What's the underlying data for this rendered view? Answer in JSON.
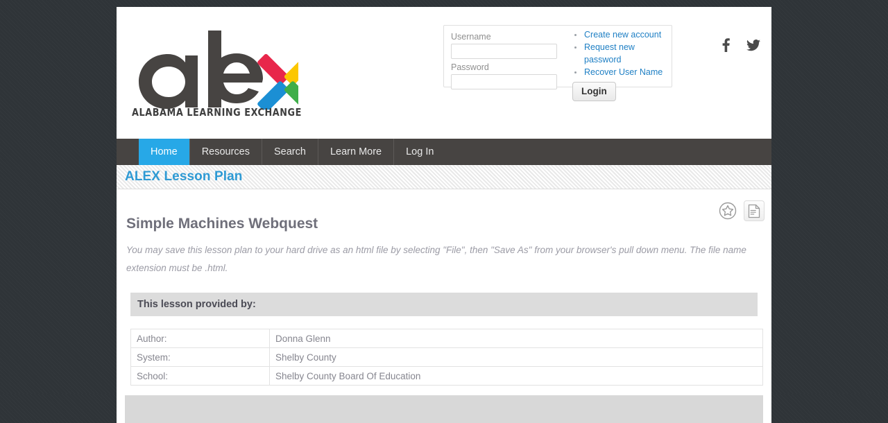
{
  "site": {
    "logo_text": "alex",
    "logo_tagline": "ALABAMA LEARNING EXCHANGE"
  },
  "login": {
    "username_label": "Username",
    "username_value": "",
    "username_placeholder": "",
    "password_label": "Password",
    "password_value": "",
    "password_placeholder": "",
    "login_button": "Login",
    "links": [
      {
        "label": "Create new account"
      },
      {
        "label": "Request new password"
      },
      {
        "label": "Recover User Name"
      }
    ]
  },
  "social": {
    "facebook": "f",
    "twitter": "twitter-bird"
  },
  "nav": {
    "items": [
      {
        "label": "Home",
        "active": true
      },
      {
        "label": "Resources",
        "active": false
      },
      {
        "label": "Search",
        "active": false
      },
      {
        "label": "Learn More",
        "active": false
      },
      {
        "label": "Log In",
        "active": false
      }
    ]
  },
  "page": {
    "banner_title": "ALEX Lesson Plan",
    "lesson_title": "Simple Machines Webquest",
    "save_note": "You may save this lesson plan to your hard drive as an html file by selecting \"File\", then \"Save As\" from your browser's pull down menu. The file name extension must be .html.",
    "tools": [
      {
        "name": "favorite-star-icon"
      },
      {
        "name": "document-icon"
      }
    ]
  },
  "provider": {
    "heading": "This lesson provided by:",
    "rows": [
      {
        "label": "Author:",
        "value": "Donna Glenn"
      },
      {
        "label": "System:",
        "value": "Shelby County"
      },
      {
        "label": "School:",
        "value": "Shelby County Board Of Education"
      }
    ]
  },
  "colors": {
    "accent_blue": "#27a8e7",
    "title_blue": "#2e9ad4",
    "nav_dark": "#474442",
    "logo_red": "#e8274b",
    "logo_yellow": "#fcc700",
    "logo_blue": "#1b8fd4",
    "logo_green": "#3fae49",
    "page_bg": "#2f3438"
  }
}
